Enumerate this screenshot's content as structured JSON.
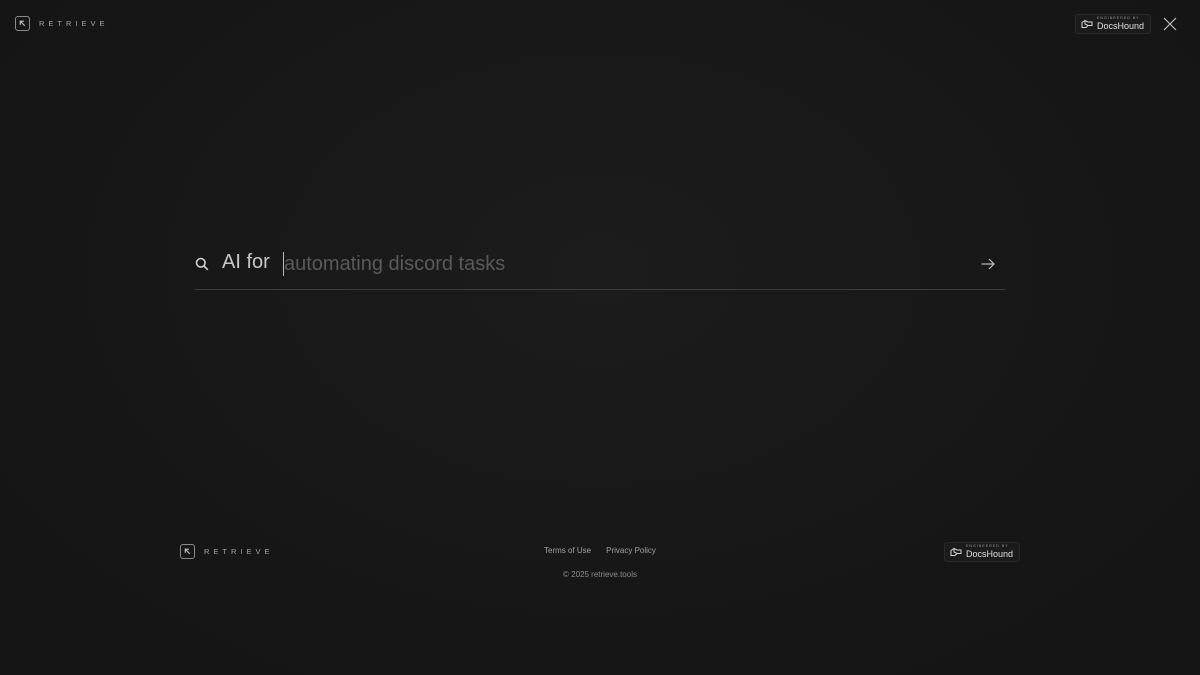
{
  "header": {
    "brand": "RETRIEVE",
    "engineered_by": "ENGINEERED BY",
    "partner": "DocsHound"
  },
  "search": {
    "prefix": "AI for",
    "value": "",
    "placeholder": "automating discord tasks"
  },
  "footer": {
    "brand": "RETRIEVE",
    "links": [
      "Terms of Use",
      "Privacy Policy"
    ],
    "copyright": "© 2025 retrieve.tools",
    "engineered_by": "ENGINEERED BY",
    "partner": "DocsHound"
  }
}
